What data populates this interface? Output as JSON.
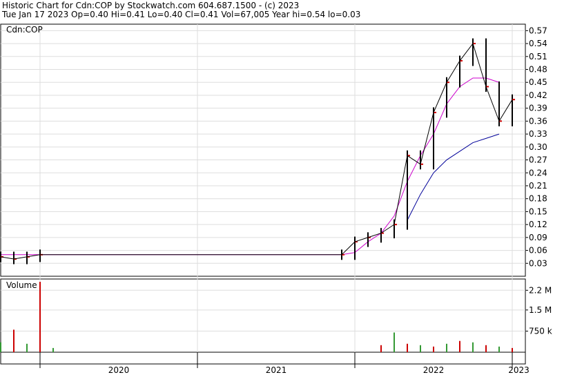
{
  "header": {
    "title": "Historic Chart for Cdn:COP by Stockwatch.com 604.687.1500 - (c) 2023",
    "quote": "Tue Jan 17 2023  Op=0.40  Hi=0.41  Lo=0.40  Cl=0.41  Vol=67,005  Year hi=0.54  lo=0.03"
  },
  "chart_data": [
    {
      "type": "line",
      "panel": "price",
      "symbol_label": "Cdn:COP",
      "y_ticks": [
        "0.57",
        "0.54",
        "0.51",
        "0.48",
        "0.45",
        "0.42",
        "0.39",
        "0.36",
        "0.33",
        "0.30",
        "0.27",
        "0.24",
        "0.21",
        "0.18",
        "0.15",
        "0.12",
        "0.09",
        "0.06",
        "0.03"
      ],
      "ylim": [
        0.0,
        0.585
      ],
      "x_ticks": [
        "2020",
        "2021",
        "2022",
        "2023"
      ],
      "xlim": [
        "2019-10",
        "2023-02"
      ],
      "grid": true,
      "colors": {
        "price": "#000000",
        "ma_short": "#cc00cc",
        "ma_long": "#000099",
        "up_day": "#cc0000",
        "volume_up": "#339933",
        "volume_down": "#cc0000",
        "grid": "#dddddd"
      },
      "series": [
        {
          "values": [
            {
              "x": "2019-10",
              "y": 0.045
            },
            {
              "x": "2019-11",
              "y": 0.04
            },
            {
              "x": "2019-12",
              "y": 0.045
            },
            {
              "x": "2020-01",
              "y": 0.05
            },
            {
              "x": "2021-12",
              "y": 0.05
            },
            {
              "x": "2022-01",
              "y": 0.08
            },
            {
              "x": "2022-02",
              "y": 0.09
            },
            {
              "x": "2022-03",
              "y": 0.1
            },
            {
              "x": "2022-04",
              "y": 0.12
            },
            {
              "x": "2022-05",
              "y": 0.28
            },
            {
              "x": "2022-06",
              "y": 0.26
            },
            {
              "x": "2022-07",
              "y": 0.38
            },
            {
              "x": "2022-08",
              "y": 0.45
            },
            {
              "x": "2022-09",
              "y": 0.5
            },
            {
              "x": "2022-10",
              "y": 0.54
            },
            {
              "x": "2022-11",
              "y": 0.44
            },
            {
              "x": "2022-12",
              "y": 0.36
            },
            {
              "x": "2023-01",
              "y": 0.41
            }
          ]
        },
        {
          "values": [
            {
              "x": "2019-10",
              "y": 0.05
            },
            {
              "x": "2021-12",
              "y": 0.05
            },
            {
              "x": "2022-01",
              "y": 0.055
            },
            {
              "x": "2022-02",
              "y": 0.08
            },
            {
              "x": "2022-03",
              "y": 0.1
            },
            {
              "x": "2022-04",
              "y": 0.14
            },
            {
              "x": "2022-05",
              "y": 0.22
            },
            {
              "x": "2022-06",
              "y": 0.28
            },
            {
              "x": "2022-07",
              "y": 0.33
            },
            {
              "x": "2022-08",
              "y": 0.4
            },
            {
              "x": "2022-09",
              "y": 0.44
            },
            {
              "x": "2022-10",
              "y": 0.46
            },
            {
              "x": "2022-11",
              "y": 0.46
            },
            {
              "x": "2022-12",
              "y": 0.45
            }
          ]
        },
        {
          "values": [
            {
              "x": "2022-05",
              "y": 0.13
            },
            {
              "x": "2022-06",
              "y": 0.19
            },
            {
              "x": "2022-07",
              "y": 0.24
            },
            {
              "x": "2022-08",
              "y": 0.27
            },
            {
              "x": "2022-09",
              "y": 0.29
            },
            {
              "x": "2022-10",
              "y": 0.31
            },
            {
              "x": "2022-11",
              "y": 0.32
            },
            {
              "x": "2022-12",
              "y": 0.33
            }
          ]
        }
      ]
    },
    {
      "type": "bar",
      "panel": "volume",
      "label": "Volume",
      "y_ticks": [
        "2.2 M",
        "1.5 M",
        "750 k"
      ],
      "y_tick_values": [
        2200000,
        1500000,
        750000
      ],
      "ylim": [
        0,
        2600000
      ],
      "x_ticks": [
        "2020",
        "2021",
        "2022",
        "2023"
      ],
      "series": [
        {
          "values": [
            {
              "x": "2019-10",
              "y": 350000
            },
            {
              "x": "2019-11",
              "y": 800000
            },
            {
              "x": "2019-12",
              "y": 300000
            },
            {
              "x": "2020-01",
              "y": 2500000
            },
            {
              "x": "2020-02",
              "y": 150000
            },
            {
              "x": "2022-03",
              "y": 250000
            },
            {
              "x": "2022-04",
              "y": 700000
            },
            {
              "x": "2022-05",
              "y": 300000
            },
            {
              "x": "2022-06",
              "y": 250000
            },
            {
              "x": "2022-07",
              "y": 200000
            },
            {
              "x": "2022-08",
              "y": 300000
            },
            {
              "x": "2022-09",
              "y": 400000
            },
            {
              "x": "2022-10",
              "y": 350000
            },
            {
              "x": "2022-11",
              "y": 250000
            },
            {
              "x": "2022-12",
              "y": 200000
            },
            {
              "x": "2023-01",
              "y": 150000
            }
          ]
        }
      ]
    }
  ]
}
